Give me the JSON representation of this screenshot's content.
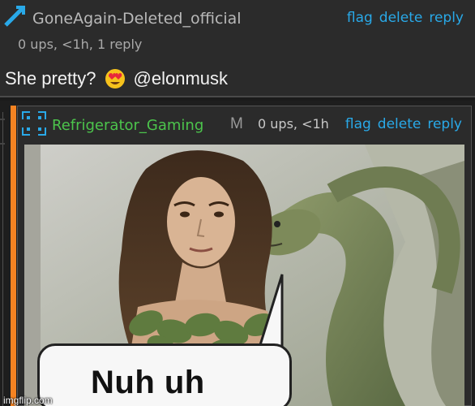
{
  "top_comment": {
    "username": "GoneAgain-Deleted_official",
    "meta": "0 ups, <1h, 1 reply",
    "actions": [
      "flag",
      "delete",
      "reply"
    ],
    "text": "She pretty?",
    "emoji_icon": "heart-eyes-emoji",
    "mention": "@elonmusk",
    "username_color": "#b9b9b9"
  },
  "reply_comment": {
    "username": "Refrigerator_Gaming",
    "badge": "M",
    "meta": "0 ups, <1h",
    "actions": [
      "flag",
      "delete",
      "reply"
    ],
    "username_color": "#4cc44c",
    "accent_color": "#f58322",
    "image": {
      "caption": "Nuh uh"
    }
  },
  "watermark": "imgflip.com",
  "colors": {
    "action_link": "#29a9e8",
    "background": "#2b2b2b"
  }
}
